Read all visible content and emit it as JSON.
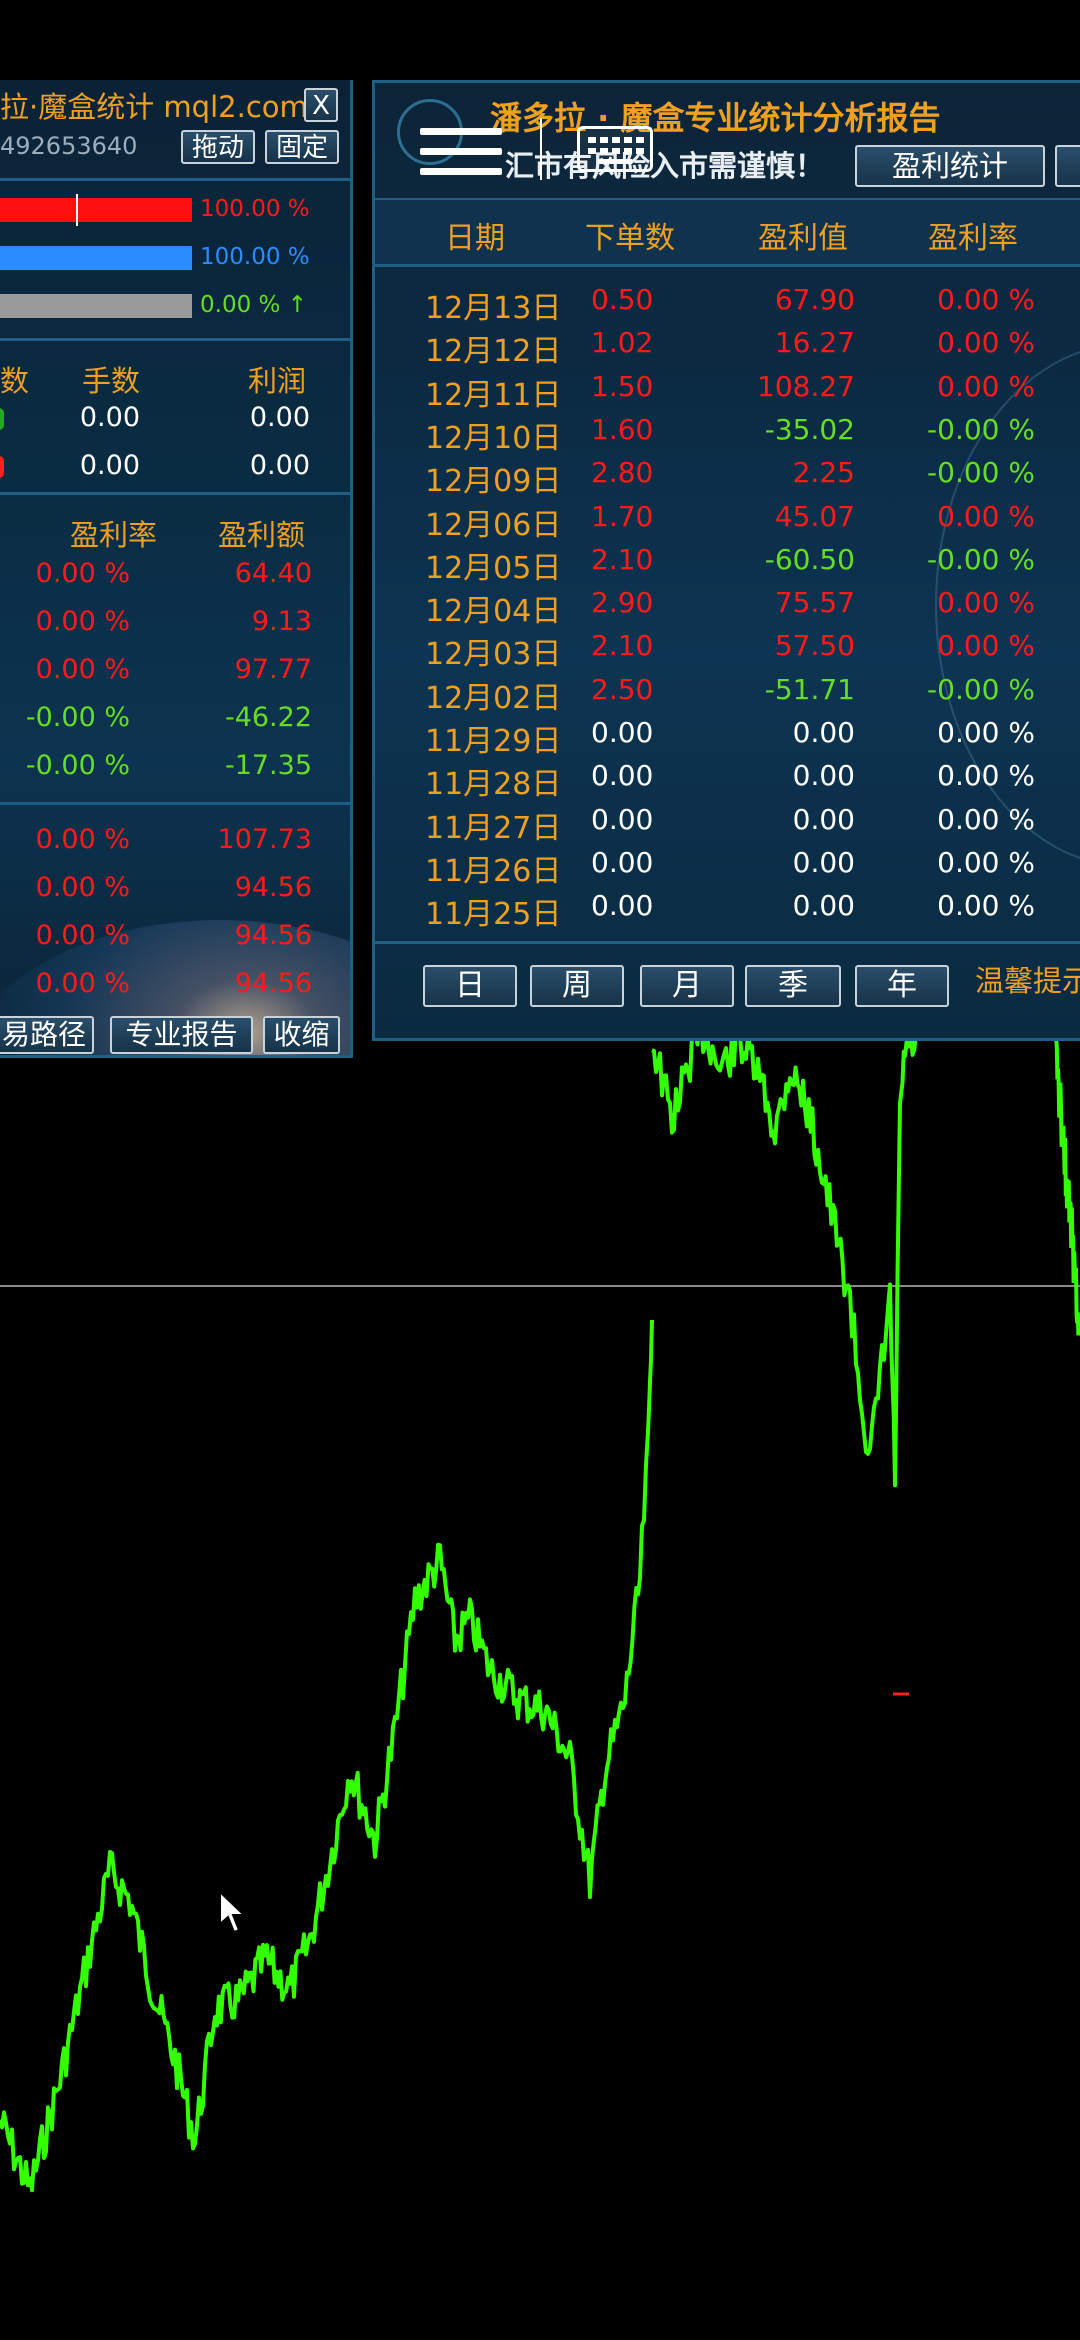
{
  "colors": {
    "accent_orange": "#f0a020",
    "loss_red": "#ff1a1a",
    "profit_green": "#66dd22",
    "neutral_white": "#ffffff",
    "bar_red": "#ff1010",
    "bar_blue": "#2a8cff",
    "bar_gray": "#9a9a9a",
    "chart_green": "#33ff00",
    "hline": "#8a8a8a"
  },
  "left_panel": {
    "title": "拉·魔盒统计 mql2.com",
    "close_label": "X",
    "account": "492653640",
    "drag_label": "拖动",
    "fix_label": "固定",
    "bars": [
      {
        "label": "100.00 %",
        "color": "red"
      },
      {
        "label": "100.00 %",
        "color": "blue"
      },
      {
        "label": "0.00 % ↑",
        "color": "gray"
      }
    ],
    "summary_headers": [
      "数",
      "手数",
      "利润"
    ],
    "summary_rows": [
      {
        "lots": "0.00",
        "profit": "0.00"
      },
      {
        "lots": "0.00",
        "profit": "0.00"
      }
    ],
    "rate_headers": [
      "盈利率",
      "盈利额"
    ],
    "rate_rows": [
      {
        "rate": "0.00 %",
        "amount": "64.40",
        "tone": "red"
      },
      {
        "rate": "0.00 %",
        "amount": "9.13",
        "tone": "red"
      },
      {
        "rate": "0.00 %",
        "amount": "97.77",
        "tone": "red"
      },
      {
        "rate": "-0.00 %",
        "amount": "-46.22",
        "tone": "green"
      },
      {
        "rate": "-0.00 %",
        "amount": "-17.35",
        "tone": "green"
      }
    ],
    "period_rows": [
      {
        "rate": "0.00 %",
        "amount": "107.73"
      },
      {
        "rate": "0.00 %",
        "amount": "94.56"
      },
      {
        "rate": "0.00 %",
        "amount": "94.56"
      },
      {
        "rate": "0.00 %",
        "amount": "94.56"
      }
    ],
    "bottom_buttons": [
      "易路径",
      "专业报告",
      "收缩"
    ]
  },
  "report": {
    "title": "潘多拉 · 魔盒专业统计分析报告",
    "subtitle": "汇市有风险入市需谨慎！",
    "profit_stats_label": "盈利统计",
    "headers": [
      "日期",
      "下单数",
      "盈利值",
      "盈利率"
    ],
    "rows": [
      {
        "date": "12月13日",
        "orders": "0.50",
        "profit": "67.90",
        "rate": "0.00 %",
        "tone": "red"
      },
      {
        "date": "12月12日",
        "orders": "1.02",
        "profit": "16.27",
        "rate": "0.00 %",
        "tone": "red"
      },
      {
        "date": "12月11日",
        "orders": "1.50",
        "profit": "108.27",
        "rate": "0.00 %",
        "tone": "red"
      },
      {
        "date": "12月10日",
        "orders": "1.60",
        "profit": "-35.02",
        "rate": "-0.00 %",
        "tone": "green"
      },
      {
        "date": "12月09日",
        "orders": "2.80",
        "profit": "2.25",
        "rate": "-0.00 %",
        "tone": "mixed"
      },
      {
        "date": "12月06日",
        "orders": "1.70",
        "profit": "45.07",
        "rate": "0.00 %",
        "tone": "red"
      },
      {
        "date": "12月05日",
        "orders": "2.10",
        "profit": "-60.50",
        "rate": "-0.00 %",
        "tone": "green"
      },
      {
        "date": "12月04日",
        "orders": "2.90",
        "profit": "75.57",
        "rate": "0.00 %",
        "tone": "red"
      },
      {
        "date": "12月03日",
        "orders": "2.10",
        "profit": "57.50",
        "rate": "0.00 %",
        "tone": "red"
      },
      {
        "date": "12月02日",
        "orders": "2.50",
        "profit": "-51.71",
        "rate": "-0.00 %",
        "tone": "green"
      },
      {
        "date": "11月29日",
        "orders": "0.00",
        "profit": "0.00",
        "rate": "0.00 %",
        "tone": "white"
      },
      {
        "date": "11月28日",
        "orders": "0.00",
        "profit": "0.00",
        "rate": "0.00 %",
        "tone": "white"
      },
      {
        "date": "11月27日",
        "orders": "0.00",
        "profit": "0.00",
        "rate": "0.00 %",
        "tone": "white"
      },
      {
        "date": "11月26日",
        "orders": "0.00",
        "profit": "0.00",
        "rate": "0.00 %",
        "tone": "white"
      },
      {
        "date": "11月25日",
        "orders": "0.00",
        "profit": "0.00",
        "rate": "0.00 %",
        "tone": "white"
      }
    ],
    "period_buttons": [
      "日",
      "周",
      "月",
      "季",
      "年"
    ],
    "tip": "温馨提示"
  },
  "overlay": {
    "menu_icon": "hamburger-menu-icon",
    "keyboard_icon": "keyboard-icon",
    "pointer_icon": "mouse-pointer-icon"
  }
}
